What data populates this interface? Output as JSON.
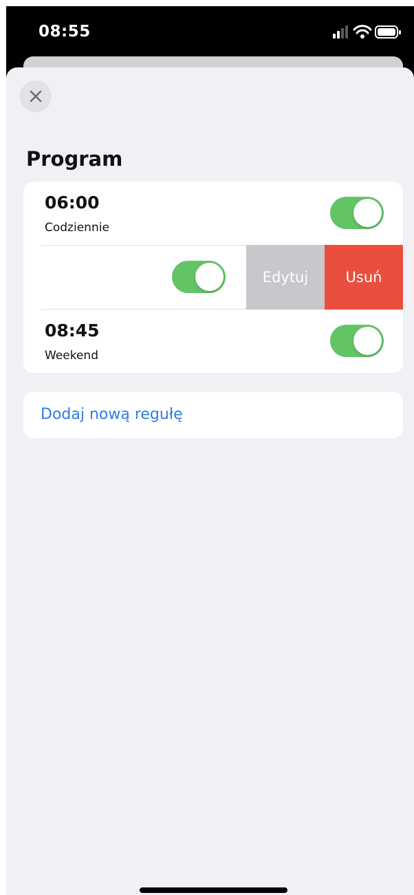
{
  "status_bar": {
    "time": "08:55",
    "icons": [
      "signal-icon",
      "wifi-icon",
      "battery-icon"
    ]
  },
  "close_icon": "close-icon",
  "section_title": "Program",
  "rules": [
    {
      "time": "06:00",
      "days": "Codziennie",
      "enabled": true
    },
    {
      "time": "",
      "days": "",
      "enabled": true,
      "swiped": true
    },
    {
      "time": "08:45",
      "days": "Weekend",
      "enabled": true
    }
  ],
  "swipe_actions": {
    "edit_label": "Edytuj",
    "delete_label": "Usuń"
  },
  "add_rule_label": "Dodaj nową regułę",
  "colors": {
    "toggle_on": "#63c466",
    "edit_action": "#c7c7cc",
    "delete_action": "#ea4e3d",
    "link": "#2f7be5",
    "sheet_background": "#f0f0f5"
  }
}
